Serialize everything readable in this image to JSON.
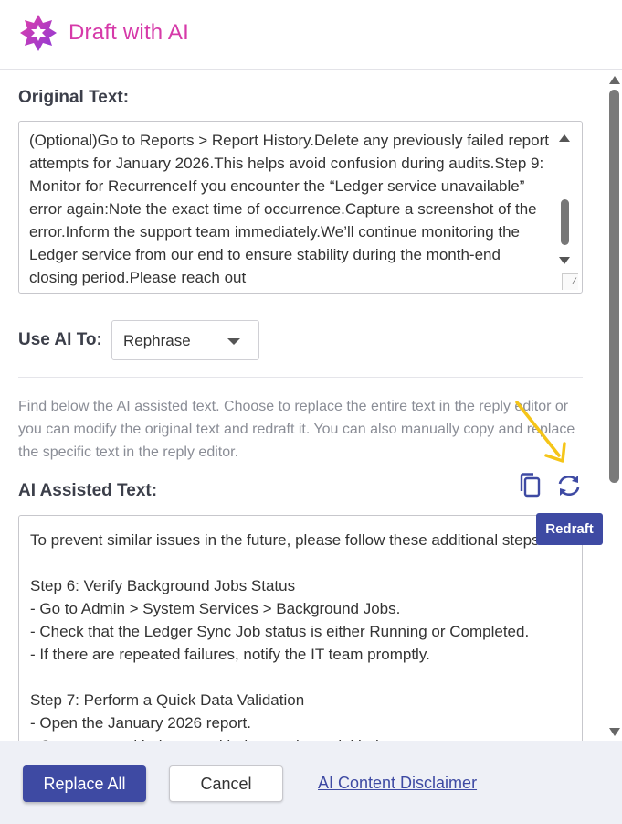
{
  "header": {
    "title": "Draft with AI",
    "logo_icon": "sparkle-flower-icon",
    "accent_color": "#d63aa9"
  },
  "original": {
    "label": "Original Text:",
    "text": "(Optional)Go to Reports > Report History.Delete any previously failed report attempts for January 2026.This helps avoid confusion during audits.Step 9: Monitor for RecurrenceIf you encounter the “Ledger service unavailable” error again:Note the exact time of occurrence.Capture a screenshot of the error.Inform the support team immediately.We’ll continue monitoring the Ledger service from our end to ensure stability during the month-end closing period.Please reach out"
  },
  "use_ai": {
    "label": "Use AI To:",
    "selected": "Rephrase"
  },
  "info_text": "Find below the AI assisted text. Choose to replace the entire text in the reply editor or you can modify the original text and redraft it. You can also manually copy and replace the specific text in the reply editor.",
  "ai": {
    "label": "AI Assisted Text:",
    "text": "To prevent similar issues in the future, please follow these additional steps:\n\nStep 6: Verify Background Jobs Status\n- Go to Admin > System Services > Background Jobs.\n- Check that the Ledger Sync Job status is either Running or Completed.\n- If there are repeated failures, notify the IT team promptly.\n\nStep 7: Perform a Quick Data Validation\n- Open the January 2026 report.\n- Compare total balances with the previous trial balance.",
    "copy_icon": "copy-icon",
    "redraft_icon": "refresh-icon",
    "tooltip": "Redraft"
  },
  "footer": {
    "replace_all": "Replace All",
    "cancel": "Cancel",
    "disclaimer": "AI Content Disclaimer"
  },
  "colors": {
    "primary": "#3e4aa3",
    "annotation_arrow": "#f5c518"
  }
}
